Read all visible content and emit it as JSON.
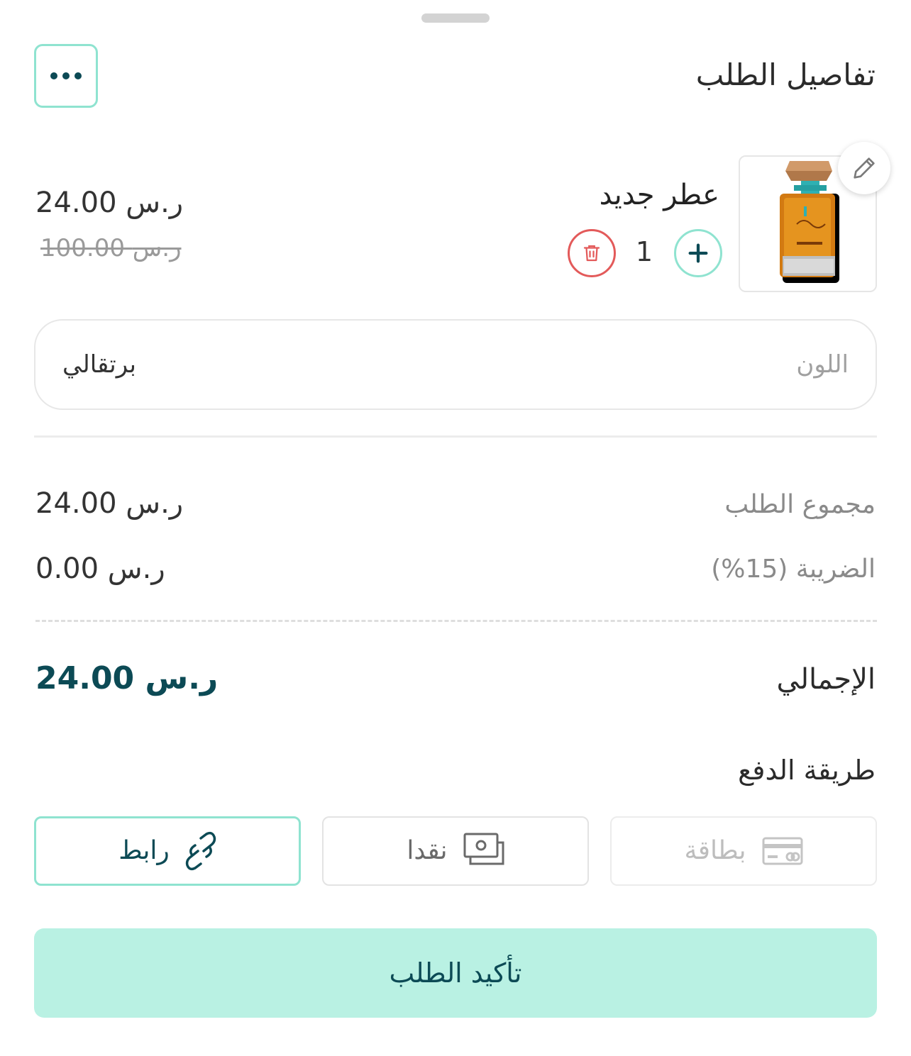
{
  "sheet": {
    "title": "تفاصيل الطلب"
  },
  "product": {
    "name": "عطر جديد",
    "quantity": "1",
    "price": "24.00 ر.س",
    "original_price": "100.00 ر.س"
  },
  "variant": {
    "label": "اللون",
    "value": "برتقالي"
  },
  "summary": {
    "subtotal_label": "مجموع الطلب",
    "subtotal_value": "24.00 ر.س",
    "tax_label": "الضريبة  (15%)",
    "tax_value": "0.00 ر.س",
    "total_label": "الإجمالي",
    "total_value": "24.00 ر.س"
  },
  "payment": {
    "title": "طريقة الدفع",
    "options": [
      {
        "label": "بطاقة",
        "icon": "credit-card-icon",
        "state": "disabled"
      },
      {
        "label": "نقدا",
        "icon": "cash-icon",
        "state": "enabled"
      },
      {
        "label": "رابط",
        "icon": "link-icon",
        "state": "selected"
      }
    ]
  },
  "actions": {
    "confirm_label": "تأكيد الطلب"
  },
  "colors": {
    "accent": "#8fe3d0",
    "primary_dark": "#0c4a55",
    "confirm_bg": "#b9f1e3",
    "danger": "#e35a5a"
  }
}
